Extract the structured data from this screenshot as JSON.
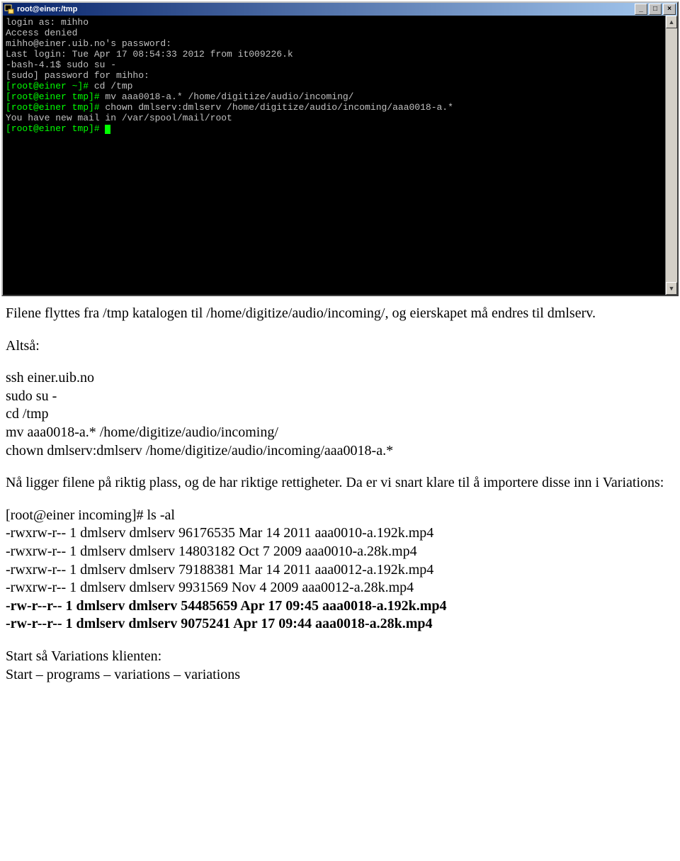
{
  "window": {
    "title": "root@einer:/tmp"
  },
  "terminal": {
    "l1": "login as: mihho",
    "l2": "Access denied",
    "l3": "mihho@einer.uib.no's password:",
    "l4": "Last login: Tue Apr 17 08:54:33 2012 from it009226.k",
    "l5": "-bash-4.1$ sudo su -",
    "l6": "[sudo] password for mihho:",
    "l7a": "[root@einer ~]#",
    "l7b": " cd /tmp",
    "l8a": "[root@einer tmp]#",
    "l8b": " mv aaa0018-a.* /home/digitize/audio/incoming/",
    "l9a": "[root@einer tmp]#",
    "l9b": " chown dmlserv:dmlserv /home/digitize/audio/incoming/aaa0018-a.*",
    "l10": "You have new mail in /var/spool/mail/root",
    "l11": "[root@einer tmp]#"
  },
  "doc": {
    "p1": "Filene flyttes fra /tmp katalogen til /home/digitize/audio/incoming/, og eierskapet må endres til dmlserv.",
    "p2": "Altså:",
    "cmds": {
      "c1": "ssh einer.uib.no",
      "c2": "sudo su -",
      "c3": "cd /tmp",
      "c4": "mv aaa0018-a.* /home/digitize/audio/incoming/",
      "c5": "chown dmlserv:dmlserv /home/digitize/audio/incoming/aaa0018-a.*"
    },
    "p3": "Nå ligger filene på riktig plass, og de har riktige rettigheter. Da er vi snart klare til å importere disse inn i Variations:",
    "ls": {
      "prompt": "[root@einer incoming]# ls -al",
      "r1": "-rwxrw-r-- 1 dmlserv  dmlserv  96176535 Mar 14  2011 aaa0010-a.192k.mp4",
      "r2": "-rwxrw-r-- 1 dmlserv  dmlserv  14803182 Oct  7  2009 aaa0010-a.28k.mp4",
      "r3": "-rwxrw-r-- 1 dmlserv  dmlserv  79188381 Mar 14  2011 aaa0012-a.192k.mp4",
      "r4": "-rwxrw-r-- 1 dmlserv  dmlserv   9931569 Nov  4  2009 aaa0012-a.28k.mp4",
      "r5": "-rw-r--r-- 1 dmlserv  dmlserv  54485659 Apr 17 09:45 aaa0018-a.192k.mp4",
      "r6": "-rw-r--r-- 1 dmlserv  dmlserv   9075241 Apr 17 09:44 aaa0018-a.28k.mp4"
    },
    "p4a": "Start så Variations klienten:",
    "p4b": "Start – programs – variations – variations"
  }
}
